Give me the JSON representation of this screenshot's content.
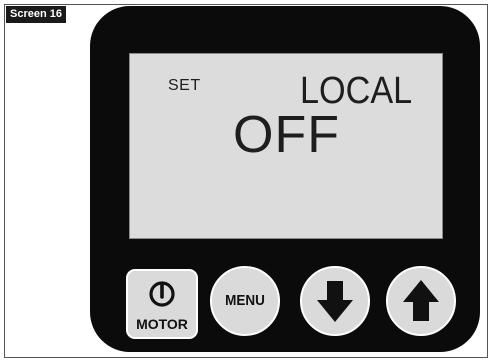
{
  "screen_tag": "Screen 16",
  "display": {
    "mode_label": "SET",
    "location_label": "LOCAL",
    "value": "OFF"
  },
  "buttons": {
    "motor_label": "MOTOR",
    "menu_label": "MENU",
    "down_icon": "arrow-down-icon",
    "up_icon": "arrow-up-icon",
    "power_icon": "power-icon"
  },
  "colors": {
    "device_body": "#0b0b0b",
    "lcd_background": "#dcdcdc",
    "button_face": "#dadada"
  }
}
